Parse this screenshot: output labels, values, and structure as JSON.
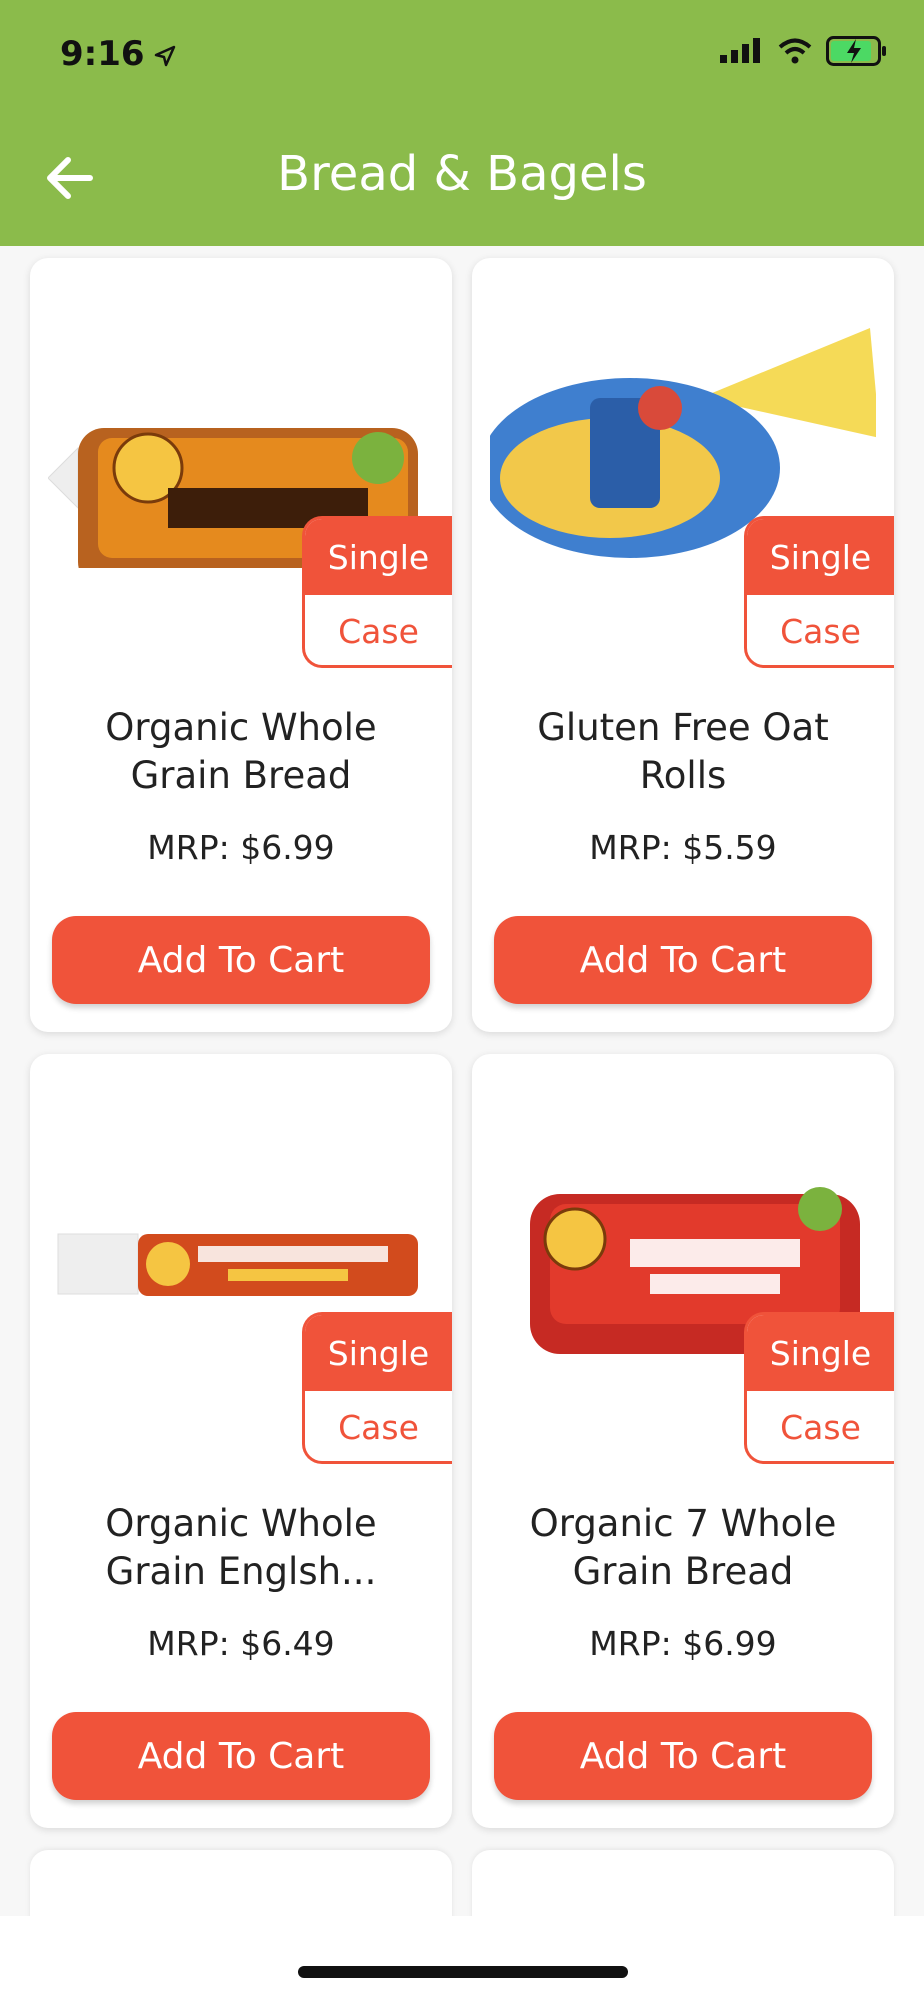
{
  "status": {
    "time": "9:16"
  },
  "header": {
    "title": "Bread & Bagels"
  },
  "products": [
    {
      "name": "Organic Whole Grain Bread",
      "price": "MRP: $6.99",
      "single": "Single",
      "case": "Case",
      "cta": "Add To Cart"
    },
    {
      "name": "Gluten Free Oat Rolls",
      "price": "MRP: $5.59",
      "single": "Single",
      "case": "Case",
      "cta": "Add To Cart"
    },
    {
      "name": "Organic Whole Grain Englsh...",
      "price": "MRP: $6.49",
      "single": "Single",
      "case": "Case",
      "cta": "Add To Cart"
    },
    {
      "name": "Organic 7 Whole Grain Bread",
      "price": "MRP: $6.99",
      "single": "Single",
      "case": "Case",
      "cta": "Add To Cart"
    }
  ],
  "colors": {
    "header": "#8bbb4b",
    "accent": "#f0533a"
  }
}
